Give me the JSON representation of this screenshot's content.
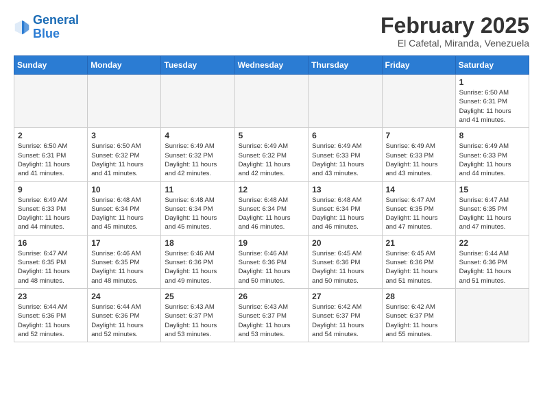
{
  "header": {
    "logo_line1": "General",
    "logo_line2": "Blue",
    "month": "February 2025",
    "location": "El Cafetal, Miranda, Venezuela"
  },
  "weekdays": [
    "Sunday",
    "Monday",
    "Tuesday",
    "Wednesday",
    "Thursday",
    "Friday",
    "Saturday"
  ],
  "weeks": [
    [
      {
        "day": "",
        "info": ""
      },
      {
        "day": "",
        "info": ""
      },
      {
        "day": "",
        "info": ""
      },
      {
        "day": "",
        "info": ""
      },
      {
        "day": "",
        "info": ""
      },
      {
        "day": "",
        "info": ""
      },
      {
        "day": "1",
        "info": "Sunrise: 6:50 AM\nSunset: 6:31 PM\nDaylight: 11 hours\nand 41 minutes."
      }
    ],
    [
      {
        "day": "2",
        "info": "Sunrise: 6:50 AM\nSunset: 6:31 PM\nDaylight: 11 hours\nand 41 minutes."
      },
      {
        "day": "3",
        "info": "Sunrise: 6:50 AM\nSunset: 6:32 PM\nDaylight: 11 hours\nand 41 minutes."
      },
      {
        "day": "4",
        "info": "Sunrise: 6:49 AM\nSunset: 6:32 PM\nDaylight: 11 hours\nand 42 minutes."
      },
      {
        "day": "5",
        "info": "Sunrise: 6:49 AM\nSunset: 6:32 PM\nDaylight: 11 hours\nand 42 minutes."
      },
      {
        "day": "6",
        "info": "Sunrise: 6:49 AM\nSunset: 6:33 PM\nDaylight: 11 hours\nand 43 minutes."
      },
      {
        "day": "7",
        "info": "Sunrise: 6:49 AM\nSunset: 6:33 PM\nDaylight: 11 hours\nand 43 minutes."
      },
      {
        "day": "8",
        "info": "Sunrise: 6:49 AM\nSunset: 6:33 PM\nDaylight: 11 hours\nand 44 minutes."
      }
    ],
    [
      {
        "day": "9",
        "info": "Sunrise: 6:49 AM\nSunset: 6:33 PM\nDaylight: 11 hours\nand 44 minutes."
      },
      {
        "day": "10",
        "info": "Sunrise: 6:48 AM\nSunset: 6:34 PM\nDaylight: 11 hours\nand 45 minutes."
      },
      {
        "day": "11",
        "info": "Sunrise: 6:48 AM\nSunset: 6:34 PM\nDaylight: 11 hours\nand 45 minutes."
      },
      {
        "day": "12",
        "info": "Sunrise: 6:48 AM\nSunset: 6:34 PM\nDaylight: 11 hours\nand 46 minutes."
      },
      {
        "day": "13",
        "info": "Sunrise: 6:48 AM\nSunset: 6:34 PM\nDaylight: 11 hours\nand 46 minutes."
      },
      {
        "day": "14",
        "info": "Sunrise: 6:47 AM\nSunset: 6:35 PM\nDaylight: 11 hours\nand 47 minutes."
      },
      {
        "day": "15",
        "info": "Sunrise: 6:47 AM\nSunset: 6:35 PM\nDaylight: 11 hours\nand 47 minutes."
      }
    ],
    [
      {
        "day": "16",
        "info": "Sunrise: 6:47 AM\nSunset: 6:35 PM\nDaylight: 11 hours\nand 48 minutes."
      },
      {
        "day": "17",
        "info": "Sunrise: 6:46 AM\nSunset: 6:35 PM\nDaylight: 11 hours\nand 48 minutes."
      },
      {
        "day": "18",
        "info": "Sunrise: 6:46 AM\nSunset: 6:36 PM\nDaylight: 11 hours\nand 49 minutes."
      },
      {
        "day": "19",
        "info": "Sunrise: 6:46 AM\nSunset: 6:36 PM\nDaylight: 11 hours\nand 50 minutes."
      },
      {
        "day": "20",
        "info": "Sunrise: 6:45 AM\nSunset: 6:36 PM\nDaylight: 11 hours\nand 50 minutes."
      },
      {
        "day": "21",
        "info": "Sunrise: 6:45 AM\nSunset: 6:36 PM\nDaylight: 11 hours\nand 51 minutes."
      },
      {
        "day": "22",
        "info": "Sunrise: 6:44 AM\nSunset: 6:36 PM\nDaylight: 11 hours\nand 51 minutes."
      }
    ],
    [
      {
        "day": "23",
        "info": "Sunrise: 6:44 AM\nSunset: 6:36 PM\nDaylight: 11 hours\nand 52 minutes."
      },
      {
        "day": "24",
        "info": "Sunrise: 6:44 AM\nSunset: 6:36 PM\nDaylight: 11 hours\nand 52 minutes."
      },
      {
        "day": "25",
        "info": "Sunrise: 6:43 AM\nSunset: 6:37 PM\nDaylight: 11 hours\nand 53 minutes."
      },
      {
        "day": "26",
        "info": "Sunrise: 6:43 AM\nSunset: 6:37 PM\nDaylight: 11 hours\nand 53 minutes."
      },
      {
        "day": "27",
        "info": "Sunrise: 6:42 AM\nSunset: 6:37 PM\nDaylight: 11 hours\nand 54 minutes."
      },
      {
        "day": "28",
        "info": "Sunrise: 6:42 AM\nSunset: 6:37 PM\nDaylight: 11 hours\nand 55 minutes."
      },
      {
        "day": "",
        "info": ""
      }
    ]
  ]
}
